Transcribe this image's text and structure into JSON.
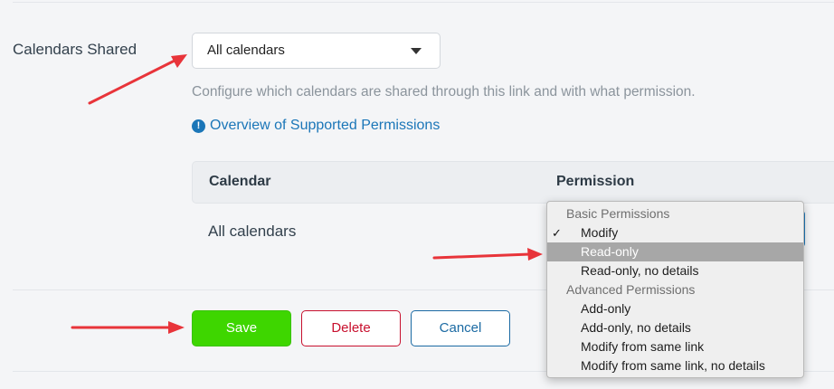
{
  "field": {
    "label": "Calendars Shared",
    "select_value": "All calendars"
  },
  "help_text": "Configure which calendars are shared through this link and with what permission.",
  "overview_link": "Overview of Supported Permissions",
  "info_icon_glyph": "!",
  "table": {
    "headers": [
      "Calendar",
      "Permission"
    ],
    "rows": [
      {
        "calendar": "All calendars"
      }
    ]
  },
  "buttons": {
    "save": "Save",
    "delete": "Delete",
    "cancel": "Cancel"
  },
  "permission_dropdown": {
    "groups": [
      {
        "label": "Basic Permissions"
      },
      {
        "label": "Advanced Permissions"
      }
    ],
    "items": [
      {
        "label": "Modify",
        "checked": true
      },
      {
        "label": "Read-only",
        "highlighted": true
      },
      {
        "label": "Read-only, no details"
      },
      {
        "label": "Add-only"
      },
      {
        "label": "Add-only, no details"
      },
      {
        "label": "Modify from same link"
      },
      {
        "label": "Modify from same link, no details"
      }
    ],
    "check_glyph": "✓"
  },
  "colors": {
    "accent_link": "#1b76b8",
    "save_green": "#3ed600",
    "delete_red": "#c8102e",
    "annotation_arrow": "#e8343a"
  }
}
